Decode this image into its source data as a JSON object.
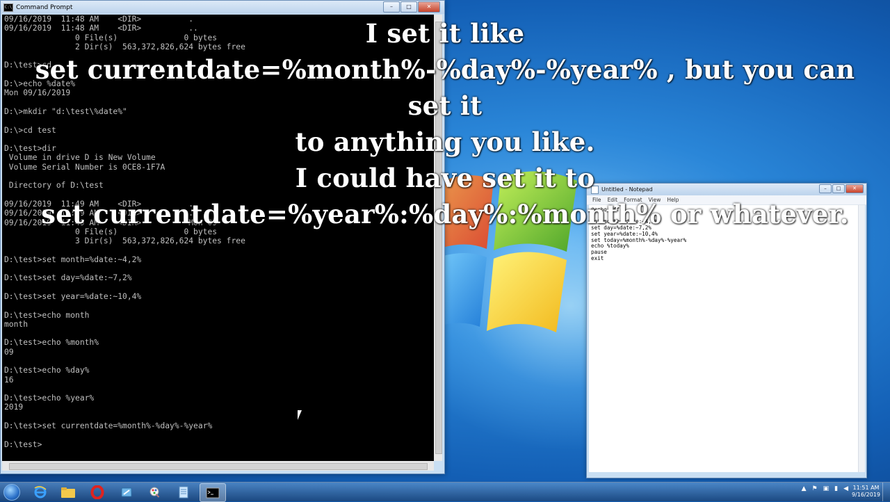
{
  "cmd_window": {
    "title": "Command Prompt",
    "icon_label": "C:\\",
    "console_lines": [
      "09/16/2019  11:48 AM    <DIR>          .",
      "09/16/2019  11:48 AM    <DIR>          ..",
      "               0 File(s)              0 bytes",
      "               2 Dir(s)  563,372,826,624 bytes free",
      "",
      "D:\\test>cd..",
      "",
      "D:\\>echo %date%",
      "Mon 09/16/2019",
      "",
      "D:\\>mkdir \"d:\\test\\%date%\"",
      "",
      "D:\\>cd test",
      "",
      "D:\\test>dir",
      " Volume in drive D is New Volume",
      " Volume Serial Number is 0CE8-1F7A",
      "",
      " Directory of D:\\test",
      "",
      "09/16/2019  11:49 AM    <DIR>          .",
      "09/16/2019  11:49 AM    <DIR>          ..",
      "09/16/2019  11:49 AM    <DIR>          Mon 09",
      "               0 File(s)              0 bytes",
      "               3 Dir(s)  563,372,826,624 bytes free",
      "",
      "D:\\test>set month=%date:~4,2%",
      "",
      "D:\\test>set day=%date:~7,2%",
      "",
      "D:\\test>set year=%date:~10,4%",
      "",
      "D:\\test>echo month",
      "month",
      "",
      "D:\\test>echo %month%",
      "09",
      "",
      "D:\\test>echo %day%",
      "16",
      "",
      "D:\\test>echo %year%",
      "2019",
      "",
      "D:\\test>set currentdate=%month%-%day%-%year%",
      "",
      "D:\\test>"
    ]
  },
  "notepad_window": {
    "title": "Untitled - Notepad",
    "menu": [
      "File",
      "Edit",
      "Format",
      "View",
      "Help"
    ],
    "lines": [
      "@echo off",
      "",
      "set month=%date:~4,2%",
      "set day=%date:~7,2%",
      "set year=%date:~10,4%",
      "set today=%month%-%day%-%year%",
      "echo %today%",
      "pause",
      "exit"
    ]
  },
  "caption": {
    "lines": [
      "I set it like",
      "set currentdate=%month%-%day%-%year% , but you can set it",
      "to anything you like.",
      "I could have set it to",
      "set currentdate=%year%:%day%:%month% or whatever."
    ]
  },
  "window_buttons": {
    "minimize": "–",
    "maximize": "□",
    "close": "✕"
  },
  "taskbar": {
    "items": [
      "ie-icon",
      "explorer-folder-icon",
      "opera-icon",
      "app-icon",
      "paint-icon",
      "notepad-icon",
      "cmd-icon"
    ],
    "active_item": "cmd-icon",
    "clock_time": "11:51 AM",
    "clock_date": "9/16/2019"
  }
}
